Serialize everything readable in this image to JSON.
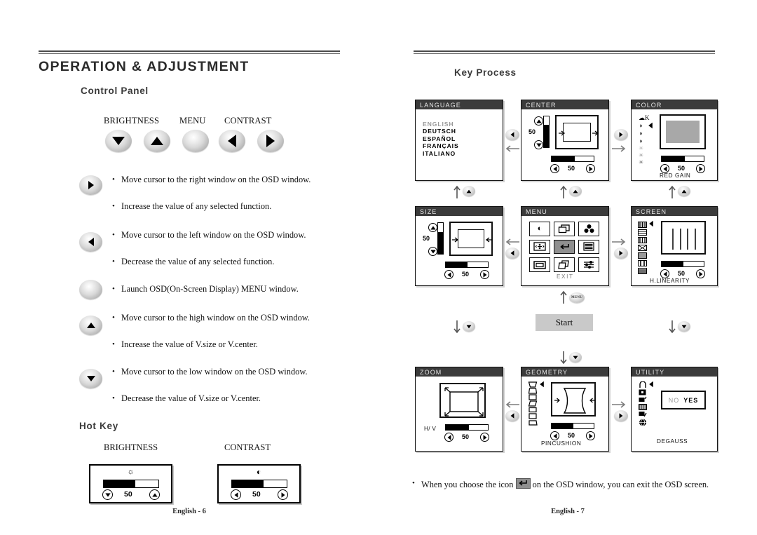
{
  "left_page": {
    "title": "OPERATION & ADJUSTMENT",
    "section_control_panel": "Control Panel",
    "panel_labels": {
      "brightness": "BRIGHTNESS",
      "menu": "MENU",
      "contrast": "CONTRAST"
    },
    "key_descriptions": [
      {
        "icon": "right-arrow-button",
        "lines": [
          "Move cursor to the right window on the OSD window.",
          "Increase the value of any selected function."
        ]
      },
      {
        "icon": "left-arrow-button",
        "lines": [
          "Move cursor to the left window on the OSD window.",
          "Decrease the value of any selected  function."
        ]
      },
      {
        "icon": "menu-button",
        "lines": [
          "Launch OSD(On-Screen Display) MENU window."
        ]
      },
      {
        "icon": "up-arrow-button",
        "lines": [
          "Move cursor to the high window on the OSD window.",
          "Increase the value of V.size or V.center."
        ]
      },
      {
        "icon": "down-arrow-button",
        "lines": [
          "Move cursor to the low window on the OSD window.",
          "Decrease the value of V.size or V.center."
        ]
      }
    ],
    "section_hot_key": "Hot Key",
    "hot_keys": [
      {
        "label": "BRIGHTNESS",
        "icon": "sun-icon",
        "value": "50",
        "fill_percent": 58,
        "left_btn": "down-arrow",
        "right_btn": "up-arrow"
      },
      {
        "label": "CONTRAST",
        "icon": "contrast-icon",
        "value": "50",
        "fill_percent": 58,
        "left_btn": "left-arrow",
        "right_btn": "right-arrow"
      }
    ],
    "page_number": "English - 6"
  },
  "right_page": {
    "section_key_process": "Key Process",
    "osd_windows": {
      "language": {
        "title": "LANGUAGE",
        "options": [
          "ENGLISH",
          "DEUTSCH",
          "ESPAÑOL",
          "FRANÇAIS",
          "ITALIANO"
        ],
        "selected": "ENGLISH"
      },
      "center": {
        "title": "CENTER",
        "vertical_value": "50",
        "horizontal_value": "50",
        "v_fill_percent": 72,
        "h_fill_percent": 55
      },
      "color": {
        "title": "COLOR",
        "value": "50",
        "caption": "RED GAIN",
        "fill_percent": 55,
        "selected_index": 1
      },
      "size": {
        "title": "SIZE",
        "vertical_value": "50",
        "horizontal_value": "50",
        "v_fill_percent": 70,
        "h_fill_percent": 52
      },
      "menu": {
        "title": "MENU",
        "exit_label": "EXIT",
        "icons": [
          "contrast-icon",
          "size-icon",
          "color-icon",
          "center-icon",
          "exit-icon",
          "screen-icon",
          "zoom-icon",
          "geometry-icon",
          "utility-icon"
        ],
        "selected_index": 4
      },
      "screen": {
        "title": "SCREEN",
        "value": "50",
        "caption": "H.LINEARITY",
        "fill_percent": 52,
        "selected_index": 0
      },
      "zoom": {
        "title": "ZOOM",
        "axis_label": "H/ V",
        "value": "50",
        "fill_percent": 55
      },
      "geometry": {
        "title": "GEOMETRY",
        "value": "50",
        "caption": "PINCUSHION",
        "fill_percent": 52,
        "selected_index": 0
      },
      "utility": {
        "title": "UTILITY",
        "caption": "DEGAUSS",
        "no_label": "NO",
        "yes_label": "YES",
        "selected_index": 0
      }
    },
    "start_label": "Start",
    "menu_key_label": "MENU",
    "note": {
      "prefix": "When you choose the icon",
      "suffix": "on the OSD window, you can exit the OSD screen."
    },
    "page_number": "English - 7"
  },
  "colors": {
    "title_bar": "#3b3b3b",
    "heading": "#2b2b2b",
    "selected_cell": "#8f8f8f",
    "start_box": "#c9c9c9",
    "dim_text": "#9a9a9a"
  }
}
